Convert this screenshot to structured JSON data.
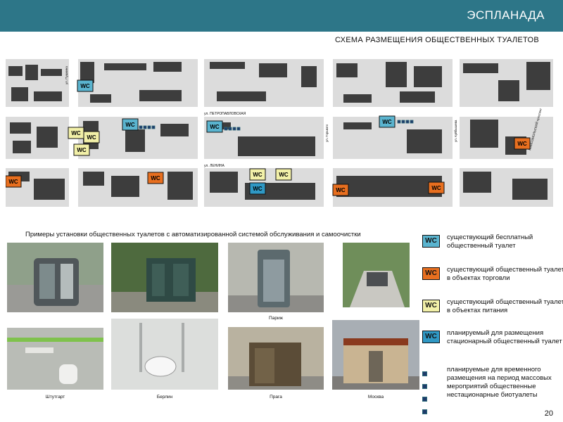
{
  "header": {
    "title": "ЭСПЛАНАДА"
  },
  "scheme_title": "СХЕМА РАЗМЕЩЕНИЯ ОБЩЕСТВЕННЫХ ТУАЛЕТОВ",
  "map": {
    "streets": {
      "vertical_1": "ул. Пушкина",
      "petropavlovskaya": "ул. ПЕТРОПАВЛОВСКАЯ",
      "lenina": "ул. ЛЕНИНА",
      "gorkogo": "ул. Горького",
      "vertical_right": "ул. Куйбышева",
      "komsomolsky": "КОМСОМОЛЬСКИЙ проспект"
    },
    "marker_label": "WC",
    "colors": {
      "free": "#5ab4cf",
      "trade": "#e86f1f",
      "food": "#f2f0a8",
      "planned": "#2f98c4",
      "buildings": "#3d3d3d",
      "blocks": "#dcdcdc"
    }
  },
  "examples_title": "Примеры установки общественных туалетов с автоматизированной системой обслуживания и самоочистки",
  "captions": {
    "paris": "Париж",
    "stuttgart": "Штутгарт",
    "berlin": "Берлин",
    "prague": "Прага",
    "moscow": "Москва"
  },
  "legend": [
    {
      "icon": "wc-free",
      "label": "WC",
      "text": "существующий бесплатный общественный туалет"
    },
    {
      "icon": "wc-trade",
      "label": "WC",
      "text": "существующий общественный туалет в объектах торговли"
    },
    {
      "icon": "wc-food",
      "label": "WC",
      "text": "существующий общественный туалет в объектах питания"
    },
    {
      "icon": "wc-planned",
      "label": "WC",
      "text": "планируемый для размещения стационарный общественный туалет"
    },
    {
      "icon": "biotoilets",
      "text": "планируемые для временного размещения на период массовых мероприятий общественные нестационарные биотуалеты"
    }
  ],
  "page_number": "20"
}
